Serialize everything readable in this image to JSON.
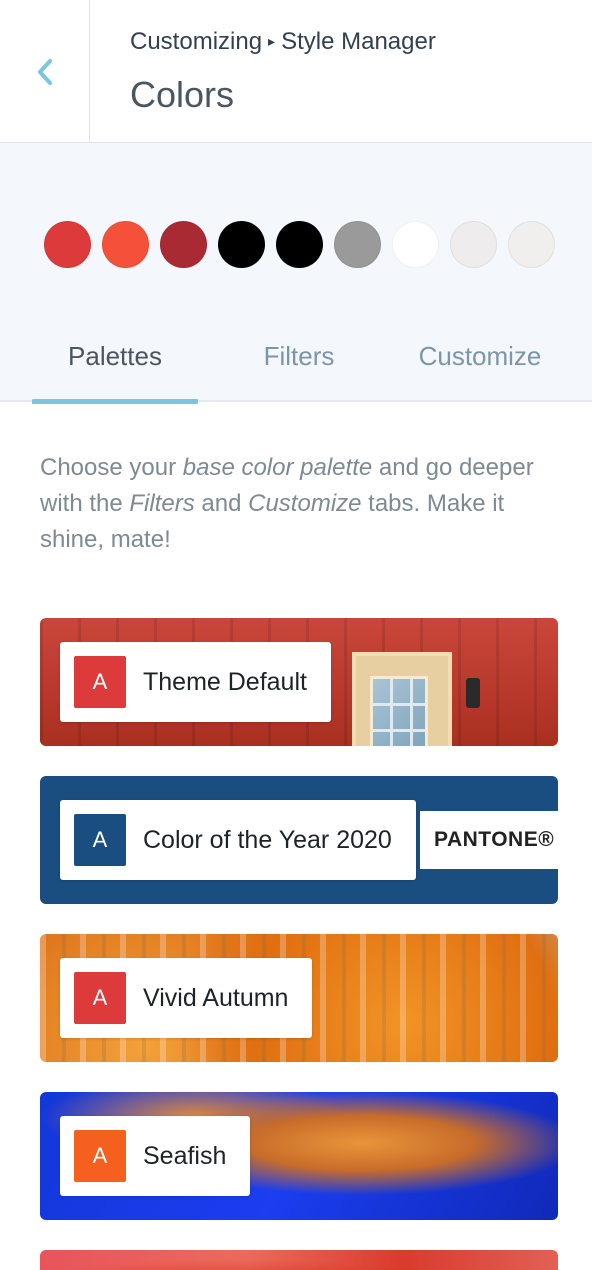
{
  "header": {
    "breadcrumb_parent": "Customizing",
    "breadcrumb_separator": "▸",
    "breadcrumb_current": "Style Manager",
    "title": "Colors",
    "back_icon": "chevron-left-icon"
  },
  "swatches": [
    {
      "color": "#dd3b3b",
      "name": "red"
    },
    {
      "color": "#f5513a",
      "name": "orange-red"
    },
    {
      "color": "#a92a33",
      "name": "dark-red"
    },
    {
      "color": "#000000",
      "name": "black"
    },
    {
      "color": "#000000",
      "name": "black-2"
    },
    {
      "color": "#9a9a9a",
      "name": "gray"
    },
    {
      "color": "#ffffff",
      "name": "white"
    },
    {
      "color": "#efeced",
      "name": "light-gray"
    },
    {
      "color": "#f1eeee",
      "name": "off-white"
    }
  ],
  "tabs": [
    {
      "label": "Palettes",
      "active": true
    },
    {
      "label": "Filters",
      "active": false
    },
    {
      "label": "Customize",
      "active": false
    }
  ],
  "description": {
    "t1": "Choose your ",
    "em1": "base color palette",
    "t2": " and go deeper with the ",
    "em2": "Filters",
    "t3": " and ",
    "em3": "Customize",
    "t4": " tabs. Make it shine, mate!"
  },
  "palettes": [
    {
      "letter": "A",
      "name": "Theme Default",
      "accent": "#dd3b3b"
    },
    {
      "letter": "A",
      "name": "Color of the Year 2020",
      "accent": "#1a4e80",
      "badge": "PANTONE®"
    },
    {
      "letter": "A",
      "name": "Vivid Autumn",
      "accent": "#dd3b3b"
    },
    {
      "letter": "A",
      "name": "Seafish",
      "accent": "#f5601e"
    }
  ]
}
